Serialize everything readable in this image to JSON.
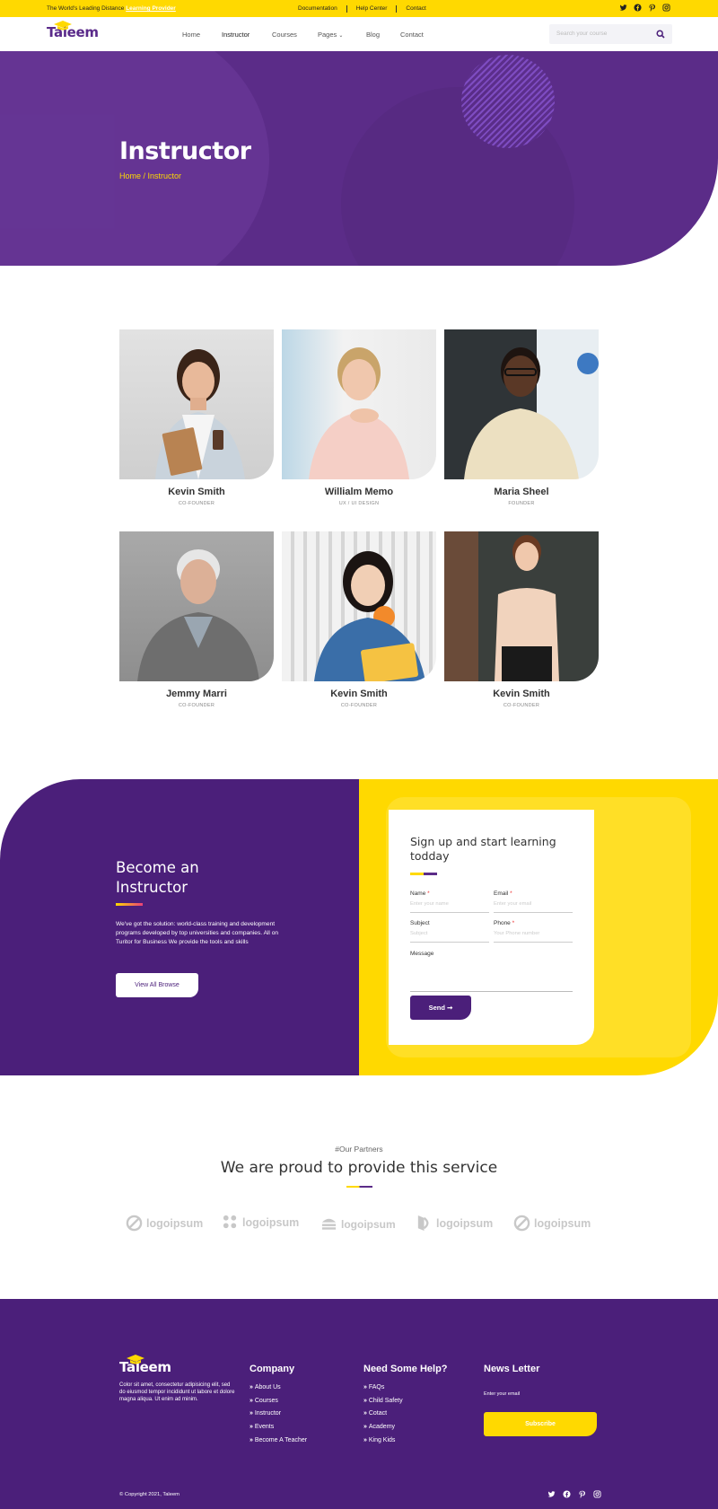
{
  "topbar": {
    "tagline_prefix": "The World's Leading Distance",
    "tagline_link": "Learning Provider",
    "links": [
      "Documentation",
      "Help Center",
      "Contact"
    ],
    "social": [
      "twitter-icon",
      "facebook-icon",
      "pinterest-icon",
      "instagram-icon"
    ]
  },
  "brand": {
    "name": "Taleem"
  },
  "nav": {
    "items": [
      "Home",
      "Instructor",
      "Courses",
      "Pages",
      "Blog",
      "Contact"
    ],
    "active": "Instructor",
    "search_placeholder": "Search your course"
  },
  "hero": {
    "title": "Instructor",
    "breadcrumb_home": "Home",
    "breadcrumb_sep": " / ",
    "breadcrumb_current": "Instructor"
  },
  "instructors": [
    {
      "name": "Kevin Smith",
      "role": "CO-FOUNDER"
    },
    {
      "name": "Willialm Memo",
      "role": "UX / UI DESIGN"
    },
    {
      "name": "Maria Sheel",
      "role": "FOUNDER"
    },
    {
      "name": "Jemmy Marri",
      "role": "CO-FOUNDER"
    },
    {
      "name": "Kevin Smith",
      "role": "CO-FOUNDER"
    },
    {
      "name": "Kevin Smith",
      "role": "CO-FOUNDER"
    }
  ],
  "become": {
    "title": "Become an Instructor",
    "text": "We've got the solution: world-class training and development programs developed by top universities and companies. All on Turitor for Business We provide the tools and skills",
    "button": "View All Browse"
  },
  "signup": {
    "title": "Sign up and start learning todday",
    "name_label": "Name",
    "name_placeholder": "Enter your name",
    "email_label": "Email",
    "email_placeholder": "Enter your email",
    "subject_label": "Subject",
    "subject_placeholder": "Subject",
    "phone_label": "Phone",
    "phone_placeholder": "Your Phone number",
    "message_label": "Message",
    "required_mark": "*",
    "send": "Send"
  },
  "partners": {
    "tag": "#Our Partners",
    "title": "We are proud to provide this service",
    "logos": [
      "logoipsum",
      "logoipsum",
      "logoipsum",
      "logoipsum",
      "logoipsum"
    ]
  },
  "footer": {
    "about": "Color sit amet, consectetur adipisicing elit, sed do eiusmod tempor incididunt ut labore et dolore magna aliqua. Ut enim ad minim.",
    "company_title": "Company",
    "company_links": [
      "About Us",
      "Courses",
      "Instructor",
      "Events",
      "Become A Teacher"
    ],
    "help_title": "Need Some Help?",
    "help_links": [
      "FAQs",
      "Child Safety",
      "Cotact",
      "Academy",
      "King Kids"
    ],
    "newsletter_title": "News Letter",
    "newsletter_placeholder": "Enter your email",
    "subscribe": "Subscribe",
    "copyright": "© Copyright 2021, Taleem"
  },
  "colors": {
    "purple": "#4b1f7a",
    "hero_purple": "#5b2c88",
    "yellow": "#FFD900"
  }
}
